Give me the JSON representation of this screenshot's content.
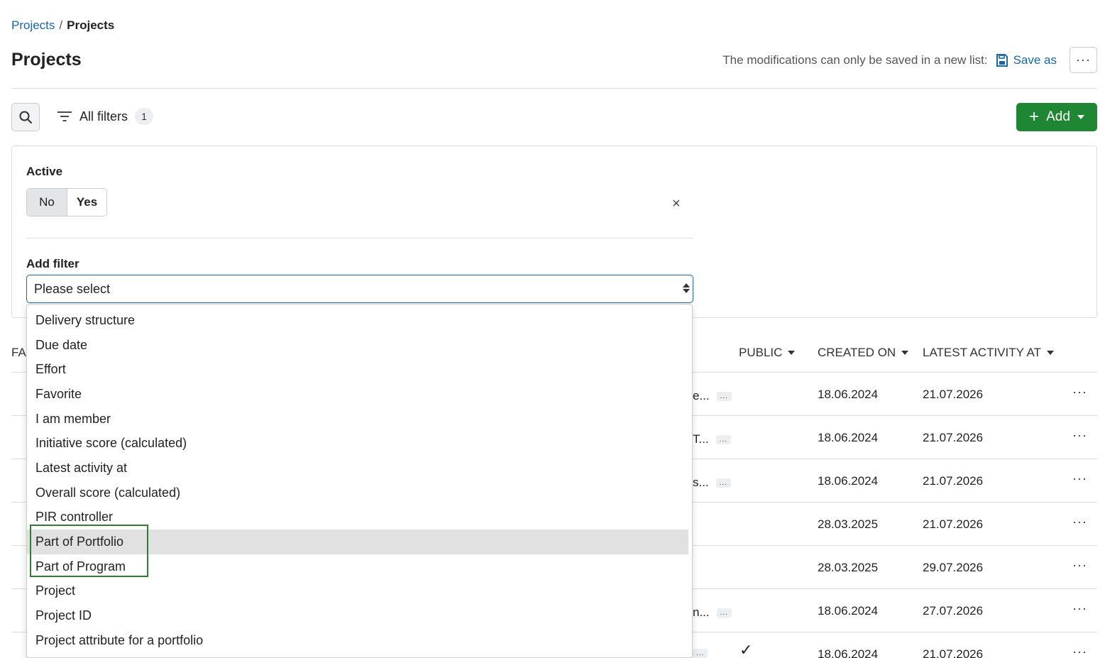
{
  "breadcrumb": {
    "link": "Projects",
    "separator": "/",
    "current": "Projects"
  },
  "page": {
    "title": "Projects"
  },
  "header": {
    "modification_notice": "The modifications can only be saved in a new list:",
    "save_as_label": "Save as",
    "more_label": "···"
  },
  "toolbar": {
    "filters_label": "All filters",
    "filters_count": "1",
    "add_label": "Add",
    "add_plus": "+"
  },
  "filter_panel": {
    "active_label": "Active",
    "toggle": {
      "no": "No",
      "yes": "Yes",
      "selected": "Yes"
    },
    "remove_icon": "×",
    "add_filter_label": "Add filter",
    "select_value": "Please select"
  },
  "table": {
    "partial_first_header": "FA",
    "headers": {
      "public": "PUBLIC",
      "created_on": "CREATED ON",
      "latest_activity": "LATEST ACTIVITY AT"
    },
    "rows": [
      {
        "trunc": "e...",
        "chip": "...",
        "created": "18.06.2024",
        "latest": "21.07.2026",
        "menu": "···"
      },
      {
        "trunc": "T...",
        "chip": "...",
        "created": "18.06.2024",
        "latest": "21.07.2026",
        "menu": "···"
      },
      {
        "trunc": "s...",
        "chip": "...",
        "created": "18.06.2024",
        "latest": "21.07.2026",
        "menu": "···"
      },
      {
        "trunc": "",
        "chip": "",
        "created": "28.03.2025",
        "latest": "21.07.2026",
        "menu": "···"
      },
      {
        "trunc": "",
        "chip": "",
        "created": "28.03.2025",
        "latest": "29.07.2026",
        "menu": "···"
      },
      {
        "trunc": "n...",
        "chip": "...",
        "created": "18.06.2024",
        "latest": "27.07.2026",
        "menu": "···"
      },
      {
        "trunc": "",
        "chip": "...",
        "created": "18.06.2024",
        "latest": "21.07.2026",
        "menu": "···",
        "public_check": "✓"
      }
    ]
  },
  "dropdown": {
    "options": [
      "Delivery structure",
      "Due date",
      "Effort",
      "Favorite",
      "I am member",
      "Initiative score (calculated)",
      "Latest activity at",
      "Overall score (calculated)",
      "PIR controller",
      "Part of Portfolio",
      "Part of Program",
      "Project",
      "Project ID",
      "Project attribute for a portfolio"
    ],
    "hovered": "Part of Portfolio"
  },
  "colors": {
    "link": "#1a67a3",
    "primary": "#1f8734",
    "highlight_border": "#2e7d32",
    "hover_bg": "#e1e1e1"
  }
}
